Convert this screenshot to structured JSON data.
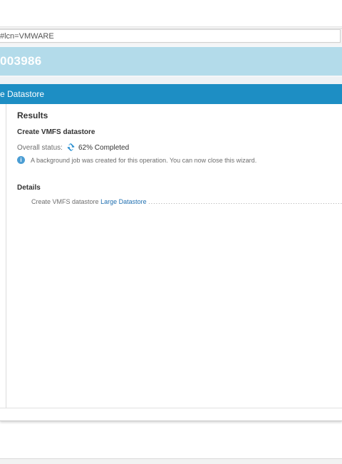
{
  "browser": {
    "address_text": "#lcn=VMWARE"
  },
  "host": {
    "title": "003986"
  },
  "wizard": {
    "title": "e Datastore",
    "results_heading": "Results",
    "operation_title": "Create VMFS datastore",
    "status_label": "Overall status:",
    "status_text": "62% Completed",
    "progress_percent": 62,
    "info_message": "A background job was created for this operation. You can now close this wizard.",
    "details_heading": "Details",
    "detail_prefix": "Create VMFS datastore",
    "detail_link": "Large Datastore",
    "detail_dots": "..........................................................................................................",
    "colors": {
      "header_blue": "#1d8ec4",
      "banner_blue": "#b3dbea",
      "link_blue": "#1f6fb0",
      "info_blue": "#4c9ed4"
    },
    "icons": {
      "status": "spinner-icon",
      "info": "info-icon"
    }
  }
}
